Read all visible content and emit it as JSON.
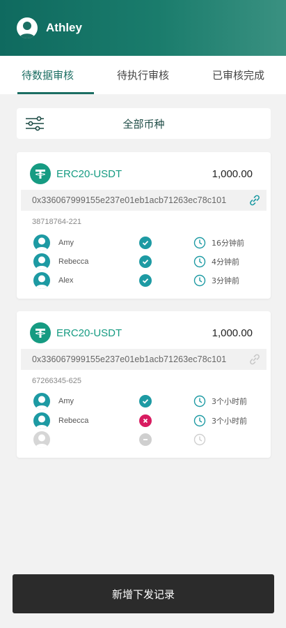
{
  "header": {
    "user_name": "Athley",
    "avatar_icon": "user-avatar-icon"
  },
  "tabs": [
    {
      "label": "待数据审核",
      "active": true
    },
    {
      "label": "待执行审核",
      "active": false
    },
    {
      "label": "已审核完成",
      "active": false
    }
  ],
  "filter": {
    "label": "全部币种",
    "icon": "filter-sliders-icon"
  },
  "cards": [
    {
      "coin": "ERC20-USDT",
      "amount": "1,000.00",
      "address": "0x336067999155e237e01eb1acb71263ec78c101",
      "link_active": true,
      "order_id": "38718764-221",
      "approvers": [
        {
          "name": "Amy",
          "status": "approved",
          "time": "16分钟前"
        },
        {
          "name": "Rebecca",
          "status": "approved",
          "time": "4分钟前"
        },
        {
          "name": "Alex",
          "status": "approved",
          "time": "3分钟前"
        }
      ]
    },
    {
      "coin": "ERC20-USDT",
      "amount": "1,000.00",
      "address": "0x336067999155e237e01eb1acb71263ec78c101",
      "link_active": false,
      "order_id": "67266345-625",
      "approvers": [
        {
          "name": "Amy",
          "status": "approved",
          "time": "3个小时前"
        },
        {
          "name": "Rebecca",
          "status": "rejected",
          "time": "3个小时前"
        },
        {
          "name": "",
          "status": "pending",
          "time": ""
        }
      ]
    }
  ],
  "bottom_button": {
    "label": "新增下发记录"
  },
  "colors": {
    "brand": "#1c6e63",
    "coin": "#169b82",
    "approved": "#1d9aa3",
    "rejected": "#d81b60",
    "pending": "#cfcfcf"
  }
}
